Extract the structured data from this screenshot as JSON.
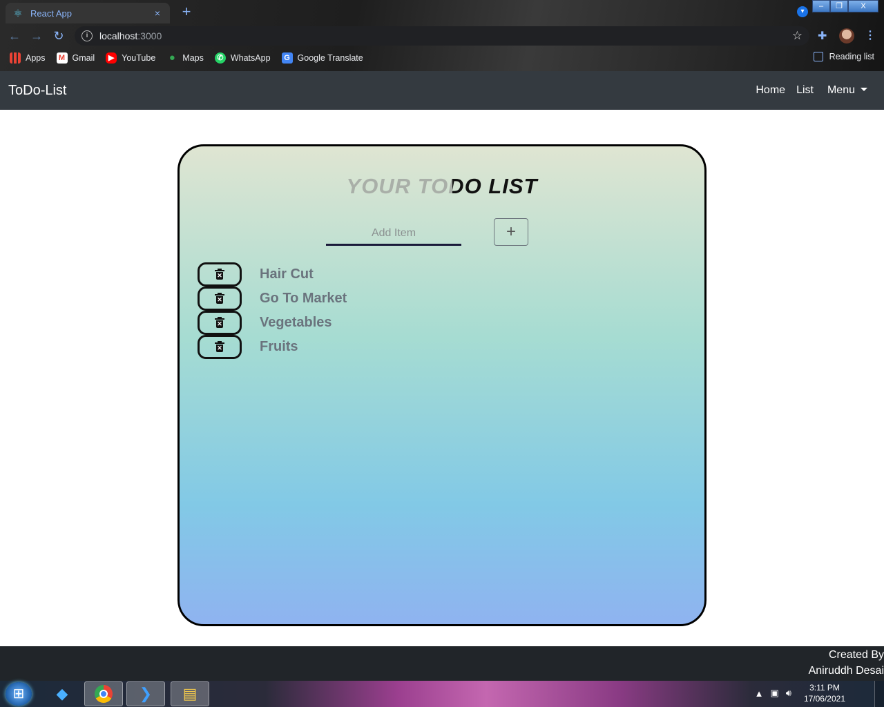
{
  "browser": {
    "tab": {
      "title": "React App",
      "favicon": "react-icon",
      "close": "×"
    },
    "new_tab": "+",
    "window_controls": {
      "min": "–",
      "max": "❐",
      "close": "X"
    },
    "url_host": "localhost",
    "url_port": ":3000",
    "bookmarks": [
      {
        "label": "Apps",
        "icon": "apps-grid-icon"
      },
      {
        "label": "Gmail",
        "icon": "gmail-icon"
      },
      {
        "label": "YouTube",
        "icon": "youtube-icon"
      },
      {
        "label": "Maps",
        "icon": "maps-icon"
      },
      {
        "label": "WhatsApp",
        "icon": "whatsapp-icon"
      },
      {
        "label": "Google Translate",
        "icon": "translate-icon"
      }
    ],
    "reading_list": "Reading list"
  },
  "navbar": {
    "brand": "ToDo-List",
    "links": [
      "Home",
      "List"
    ],
    "menu": "Menu"
  },
  "todo": {
    "title": "YOUR TODO LIST",
    "input_placeholder": "Add Item",
    "input_value": "",
    "add_label": "+",
    "items": [
      "Hair Cut",
      "Go To Market",
      "Vegetables",
      "Fruits"
    ]
  },
  "footer": {
    "line1": "Created By",
    "line2": "Aniruddh Desai"
  },
  "taskbar": {
    "time": "3:11 PM",
    "date": "17/06/2021"
  },
  "colors": {
    "navbar_bg": "#343a40",
    "footer_bg": "#212529",
    "card_gradient_top": "#dfe5d2",
    "card_gradient_bottom": "#8fb3f0",
    "item_text": "#6a737d"
  }
}
